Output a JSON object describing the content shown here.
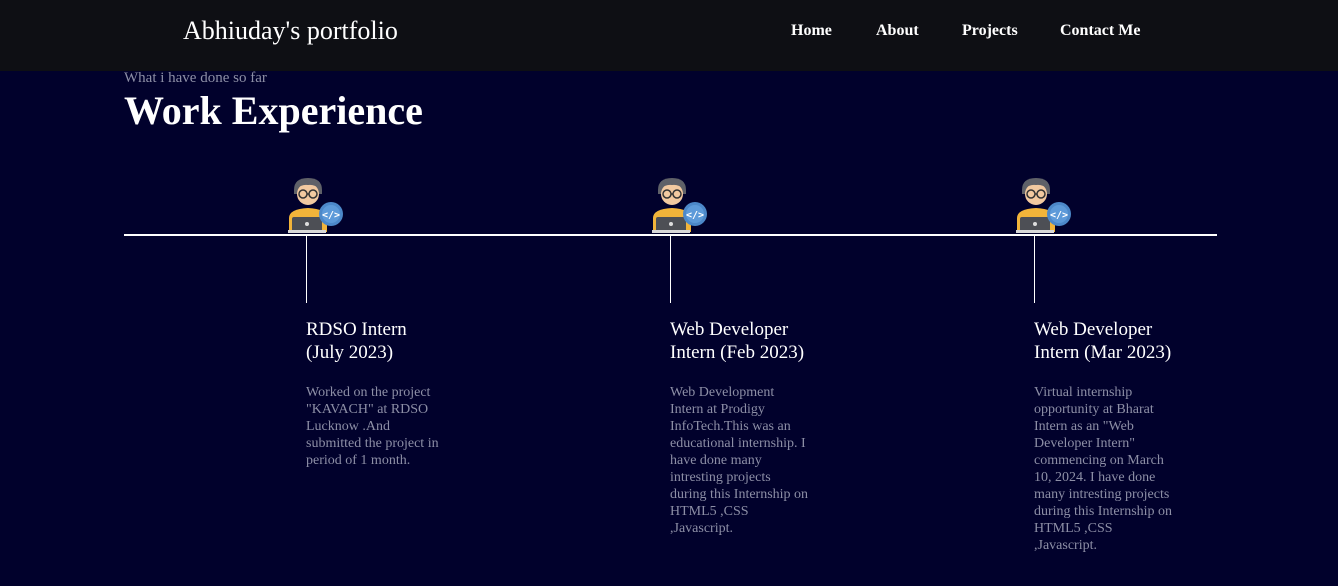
{
  "navbar": {
    "brand": "Abhiuday's portfolio",
    "links": [
      "Home",
      "About",
      "Projects",
      "Contact Me"
    ]
  },
  "section": {
    "subtitle": "What i have done so far",
    "title": "Work Experience"
  },
  "experiences": [
    {
      "title_line1": "RDSO Intern",
      "title_line2": "(July 2023)",
      "description_lines": [
        "Worked on the project",
        "\"KAVACH\" at RDSO",
        "Lucknow .And",
        "submitted the project in",
        "period of 1 month."
      ],
      "icon": "developer-avatar-icon"
    },
    {
      "title_line1": "Web Developer",
      "title_line2": "Intern (Feb 2023)",
      "description_lines": [
        "Web Development",
        "Intern at Prodigy",
        "InfoTech.This was an",
        "educational internship. I",
        "have done many",
        "intresting projects",
        "during this Internship on",
        "HTML5 ,CSS",
        ",Javascript."
      ],
      "icon": "developer-avatar-icon"
    },
    {
      "title_line1": "Web Developer",
      "title_line2": "Intern (Mar 2023)",
      "description_lines": [
        "Virtual internship",
        "opportunity at Bharat",
        "Intern as an \"Web",
        "Developer Intern\"",
        "commencing on March",
        "10, 2024. I have done",
        "many intresting projects",
        "during this Internship on",
        "HTML5 ,CSS",
        ",Javascript."
      ],
      "icon": "developer-avatar-icon"
    }
  ],
  "colors": {
    "page_background": "#01012c",
    "navbar_background": "#0e0f14",
    "muted_text": "#8d8fa6",
    "text": "#ffffff"
  }
}
